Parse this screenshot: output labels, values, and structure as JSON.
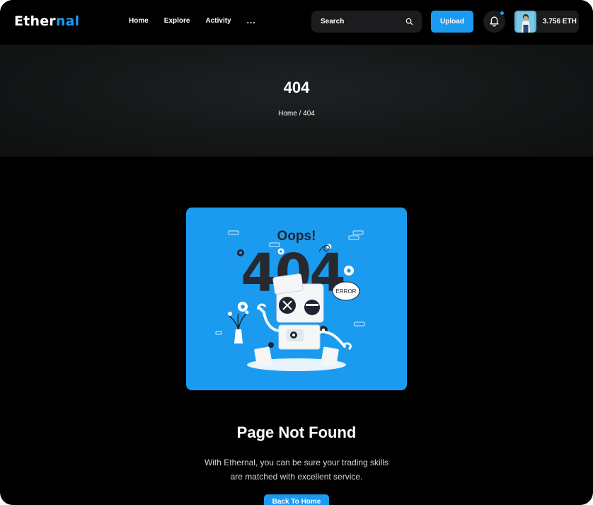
{
  "header": {
    "logo_main": "Ether",
    "logo_accent": "nal",
    "nav": [
      "Home",
      "Explore",
      "Activity",
      "..."
    ],
    "search": {
      "placeholder": "Search"
    },
    "upload_label": "Upload",
    "wallet": {
      "amount": "3.756 ETH"
    }
  },
  "hero": {
    "title": "404",
    "breadcrumb": "Home / 404"
  },
  "illustration": {
    "oops": "Oops!",
    "code": "404",
    "error_bubble": "ERROR"
  },
  "main": {
    "title": "Page Not Found",
    "desc_line1": "With Ethernal, you can be sure your trading skills",
    "desc_line2": "are matched with excellent service.",
    "back_label": "Back To Home"
  },
  "colors": {
    "accent": "#1b9bf0",
    "background": "#000000"
  }
}
